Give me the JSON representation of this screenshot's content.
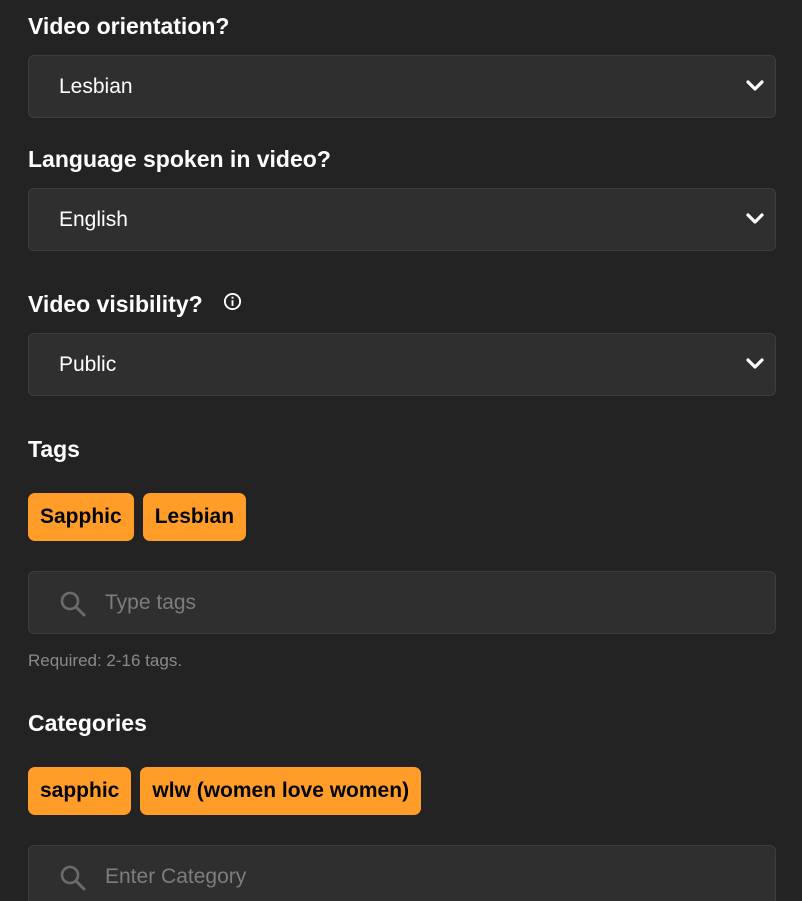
{
  "orientation": {
    "label": "Video orientation?",
    "value": "Lesbian"
  },
  "language": {
    "label": "Language spoken in video?",
    "value": "English"
  },
  "visibility": {
    "label": "Video visibility?",
    "value": "Public",
    "info_icon": "info-circle-icon"
  },
  "tags": {
    "label": "Tags",
    "chips": [
      "Sapphic",
      "Lesbian"
    ],
    "placeholder": "Type tags",
    "hint": "Required: 2-16 tags."
  },
  "categories": {
    "label": "Categories",
    "chips": [
      "sapphic",
      "wlw (women love women)"
    ],
    "placeholder": "Enter Category"
  },
  "colors": {
    "background": "#232323",
    "field": "#2f2f2f",
    "chip": "#ff9d28",
    "chip_text": "#000000",
    "placeholder": "#7d7d7d",
    "hint": "#8a8a8a"
  }
}
